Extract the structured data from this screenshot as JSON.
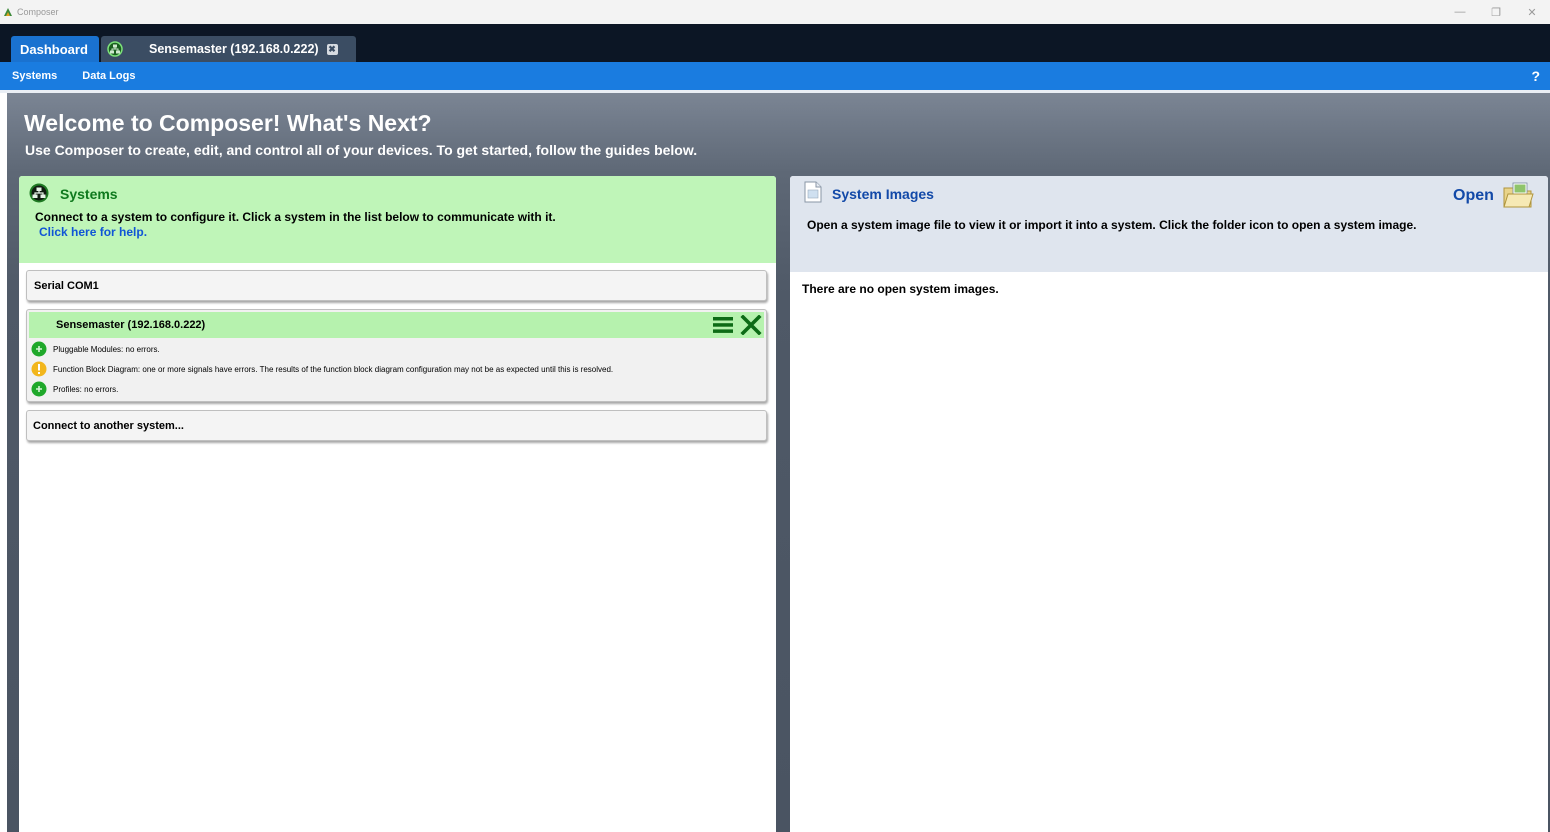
{
  "window": {
    "title": "Composer",
    "controls": [
      "—",
      "❐",
      "✕"
    ]
  },
  "tabs": {
    "dashboard_label": "Dashboard",
    "device_label": "Sensemaster (192.168.0.222)",
    "device_close": "✖"
  },
  "menu": {
    "systems": "Systems",
    "data_logs": "Data Logs",
    "help_glyph": "?"
  },
  "welcome": {
    "title": "Welcome to Composer! What's Next?",
    "subtitle": "Use Composer to create, edit, and control all of your devices. To get started, follow the guides below."
  },
  "systems_panel": {
    "title": "Systems",
    "description": "Connect to a system to configure it. Click a system in the list below to communicate with it.",
    "help_link": "Click here for help.",
    "items": {
      "serial": "Serial COM1",
      "device": {
        "name": "Sensemaster (192.168.0.222)",
        "statuses": [
          {
            "level": "ok",
            "text": "Pluggable Modules: no errors."
          },
          {
            "level": "warning",
            "text": "Function Block Diagram: one or more signals have errors. The results of the function block diagram configuration may not be as expected until this is resolved."
          },
          {
            "level": "ok",
            "text": "Profiles: no errors."
          }
        ]
      },
      "connect_other": "Connect to another system..."
    }
  },
  "images_panel": {
    "title": "System Images",
    "open_label": "Open",
    "description": "Open a system image file to view it or import it into a system. Click the folder icon to open a system image.",
    "empty_text": "There are no open system images."
  },
  "colors": {
    "tab_strip": "#0c1625",
    "menu_bar": "#1a7ce0",
    "systems_header": "#bff5b8",
    "images_header": "#dfe5ee",
    "ok_icon": "#1fa82a",
    "warning_icon": "#f2b61c",
    "link": "#1055d6"
  }
}
